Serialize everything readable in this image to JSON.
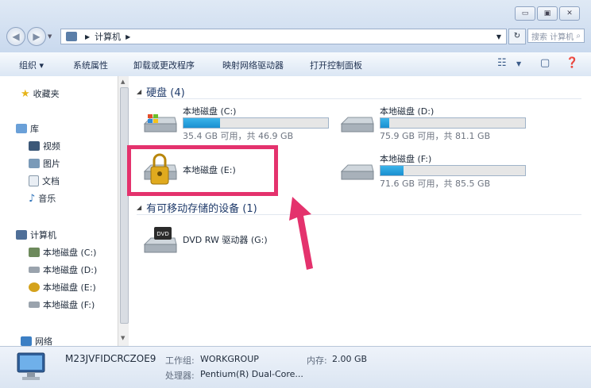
{
  "window": {
    "buttons": [
      "▭",
      "▣",
      "✕"
    ]
  },
  "nav": {
    "breadcrumb": "计算机",
    "search_placeholder": "搜索 计算机"
  },
  "toolbar": {
    "items": [
      "组织 ▾",
      "系统属性",
      "卸载或更改程序",
      "映射网络驱动器",
      "打开控制面板"
    ]
  },
  "sidebar": {
    "favorites": "收藏夹",
    "library": "库",
    "library_items": [
      "视频",
      "图片",
      "文档",
      "音乐"
    ],
    "computer": "计算机",
    "computer_items": [
      "本地磁盘 (C:)",
      "本地磁盘 (D:)",
      "本地磁盘 (E:)",
      "本地磁盘 (F:)"
    ],
    "network": "网络"
  },
  "main": {
    "hard_disks_header": "硬盘 (4)",
    "removable_header": "有可移动存储的设备 (1)",
    "drives": {
      "c": {
        "name": "本地磁盘 (C:)",
        "space": "35.4 GB 可用，共 46.9 GB",
        "used_fraction": 0.25
      },
      "d": {
        "name": "本地磁盘 (D:)",
        "space": "75.9 GB 可用，共 81.1 GB",
        "used_fraction": 0.06
      },
      "e": {
        "name": "本地磁盘 (E:)"
      },
      "f": {
        "name": "本地磁盘 (F:)",
        "space": "71.6 GB 可用，共 85.5 GB",
        "used_fraction": 0.16
      },
      "dvd": {
        "name": "DVD RW 驱动器 (G:)"
      }
    }
  },
  "details": {
    "computer_name": "M23JVFIDCRCZOE9",
    "workgroup_label": "工作组:",
    "workgroup_value": "WORKGROUP",
    "memory_label": "内存:",
    "memory_value": "2.00 GB",
    "processor_label": "处理器:",
    "processor_value": "Pentium(R) Dual-Core..."
  },
  "colors": {
    "highlight": "#e4326d",
    "progress": "#1a8fd0"
  }
}
